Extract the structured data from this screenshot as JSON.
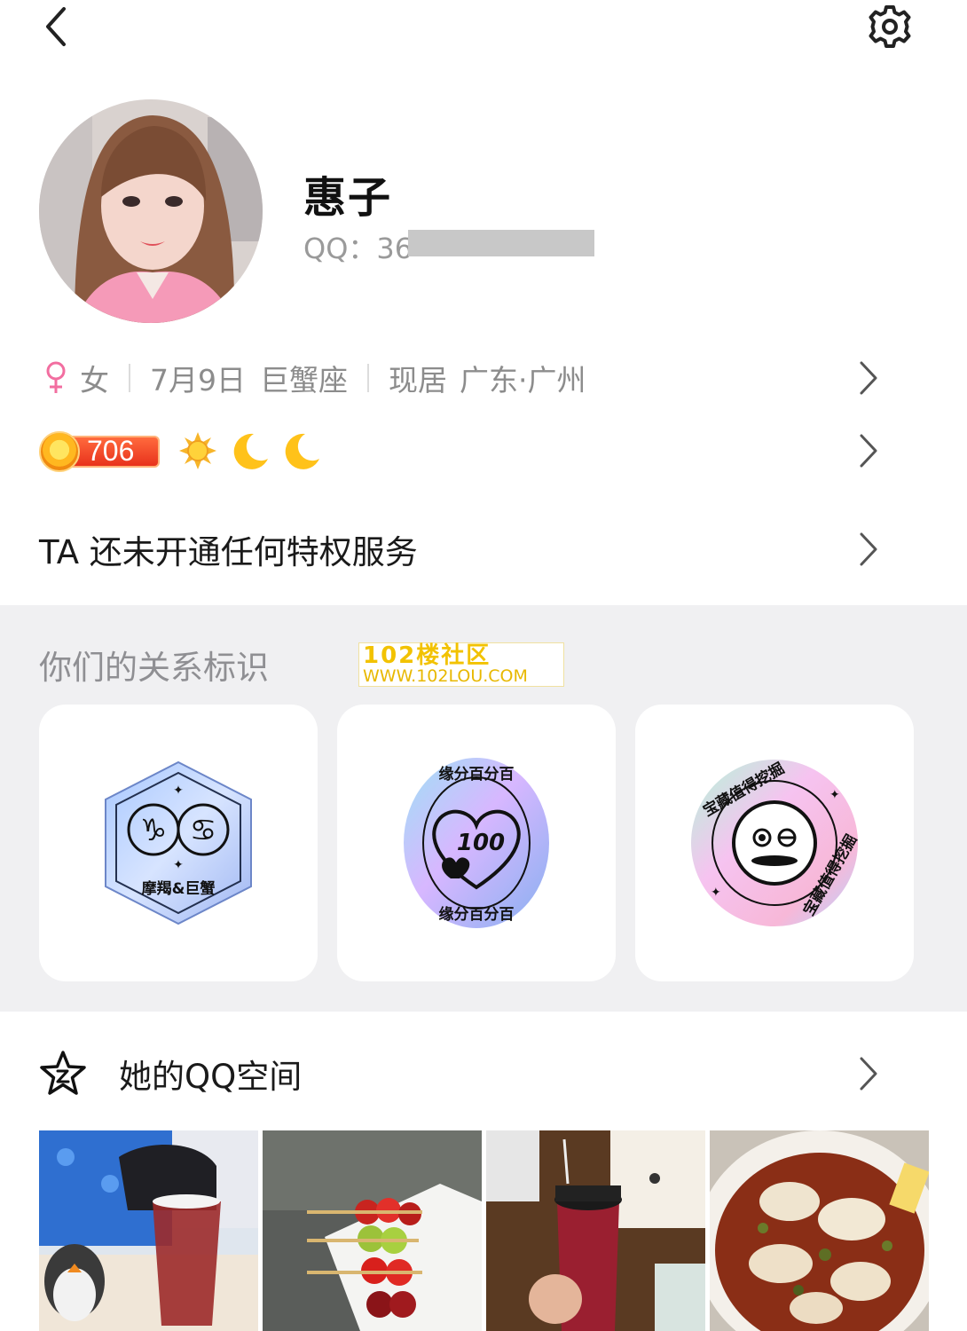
{
  "profile": {
    "nickname": "惠子",
    "qq_label": "QQ：36"
  },
  "info": {
    "gender": "女",
    "birthday": "7月9日",
    "zodiac": "巨蟹座",
    "location_prefix": "现居",
    "location": "广东·广州"
  },
  "level": {
    "value": "706",
    "icons": [
      "sun-icon",
      "moon-icon",
      "moon-icon"
    ]
  },
  "privilege": {
    "text": "TA 还未开通任何特权服务"
  },
  "relationship": {
    "title": "你们的关系标识",
    "badges": [
      {
        "icon": "capricorn-cancer-badge-icon",
        "label": "摩羯&巨蟹"
      },
      {
        "icon": "heart-100-badge-icon",
        "label": "缘分百分百",
        "number": "100"
      },
      {
        "icon": "treasure-badge-icon",
        "label": "宝藏值得挖掘"
      }
    ]
  },
  "watermark": {
    "line1": "102楼社区",
    "line2": "WWW.102LOU.COM"
  },
  "qzone": {
    "title": "她的QQ空间",
    "icon": "qzone-star-icon"
  },
  "colors": {
    "accent_orange": "#e8321c",
    "female_pink": "#f26ea0",
    "section_bg": "#f0f0f2"
  }
}
